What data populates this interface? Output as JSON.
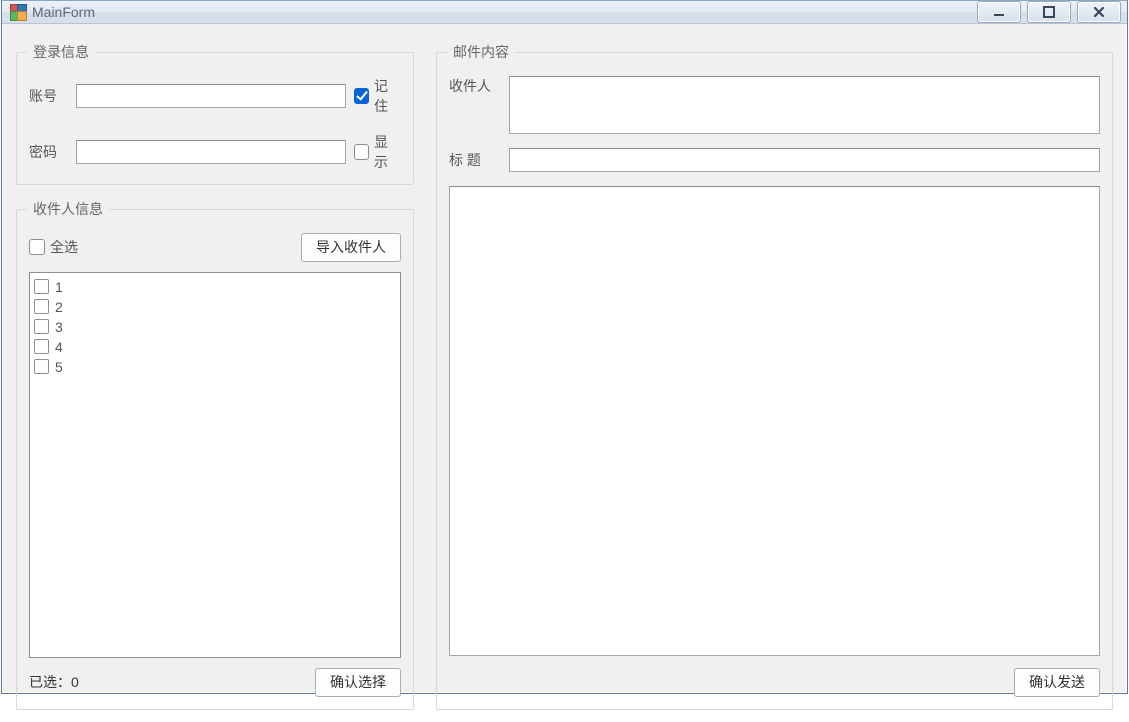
{
  "window": {
    "title": "MainForm"
  },
  "login": {
    "legend": "登录信息",
    "account_label": "账号",
    "account_value": "",
    "remember_label": "记住",
    "remember_checked": true,
    "password_label": "密码",
    "password_value": "",
    "show_label": "显示",
    "show_checked": false
  },
  "recipients": {
    "legend": "收件人信息",
    "select_all_label": "全选",
    "select_all_checked": false,
    "import_label": "导入收件人",
    "items": [
      {
        "label": "1",
        "checked": false
      },
      {
        "label": "2",
        "checked": false
      },
      {
        "label": "3",
        "checked": false
      },
      {
        "label": "4",
        "checked": false
      },
      {
        "label": "5",
        "checked": false
      }
    ],
    "selected_text": "已选：0",
    "confirm_select_label": "确认选择"
  },
  "mail": {
    "legend": "邮件内容",
    "to_label": "收件人",
    "to_value": "",
    "subject_label": "标 题",
    "subject_value": "",
    "body_value": "",
    "send_label": "确认发送"
  }
}
